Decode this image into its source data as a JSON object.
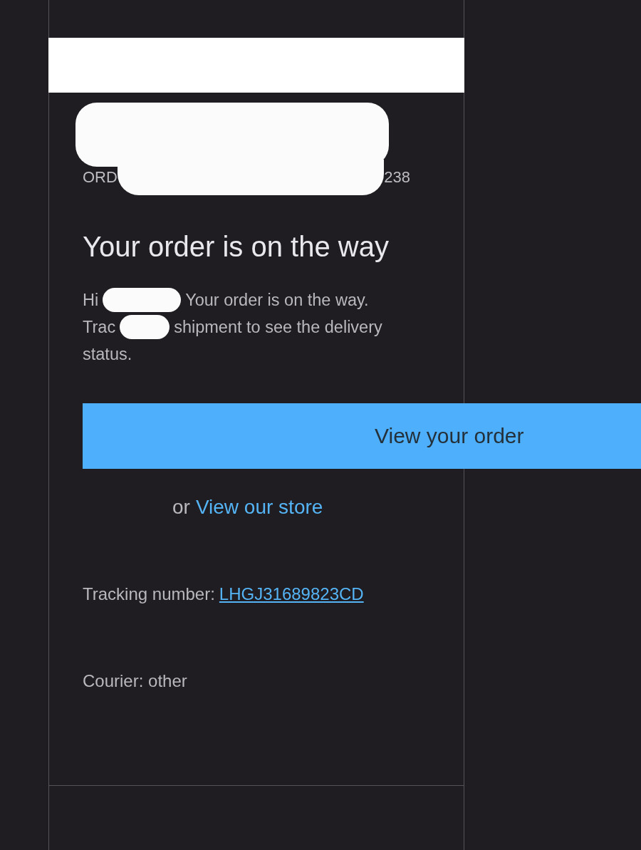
{
  "order_ref": {
    "start": "ORD",
    "end": "238"
  },
  "heading": "Your order is on the way",
  "message": {
    "greeting": "Hi",
    "line1": "Your order is on the way.",
    "track": "Trac",
    "line2": "shipment to see the delivery",
    "line3": "status."
  },
  "primary_button": "View your order",
  "alt_link": {
    "prefix": "or",
    "link": "View our store"
  },
  "tracking": {
    "label": "Tracking number:",
    "number": "LHGJ31689823CD"
  },
  "courier": "Courier: other"
}
